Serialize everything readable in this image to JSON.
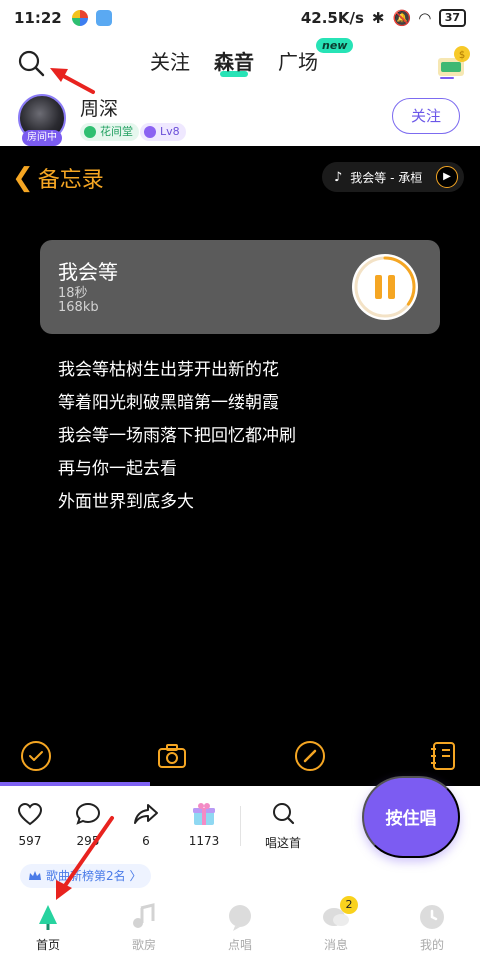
{
  "status_bar": {
    "time": "11:22",
    "network_speed": "42.5K/s",
    "battery": "37"
  },
  "top_nav": {
    "tabs": [
      "关注",
      "森音",
      "广场"
    ],
    "active_tab": "森音",
    "new_badge": "new"
  },
  "user": {
    "name": "周深",
    "room_badge": "房间中",
    "tag_1": "花间堂",
    "tag_2": "Lv8",
    "follow_label": "关注"
  },
  "memo": {
    "title": "备忘录",
    "now_playing": "我会等 - 承桓"
  },
  "audio": {
    "title": "我会等",
    "duration": "18秒",
    "size": "168kb",
    "progress": 0.35
  },
  "lyrics": [
    "我会等枯树生出芽开出新的花",
    "等着阳光刺破黑暗第一缕朝霞",
    "我会等一场雨落下把回忆都冲刷",
    "再与你一起去看",
    "外面世界到底多大"
  ],
  "stats": {
    "likes": "597",
    "comments": "295",
    "shares": "6",
    "gifts": "1173",
    "sing_this": "唱这首"
  },
  "sing_button": "按住唱",
  "rank_chip": "歌曲新榜第2名 〉",
  "bottom_nav": {
    "items": [
      "首页",
      "歌房",
      "点唱",
      "消息",
      "我的"
    ],
    "active": "首页",
    "message_count": "2"
  },
  "colors": {
    "accent_purple": "#7c5cf2",
    "accent_orange": "#f5a623",
    "accent_green": "#27e3b6",
    "annotation_red": "#e8231f"
  }
}
